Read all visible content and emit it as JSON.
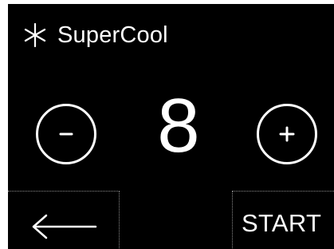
{
  "mode": {
    "title": "SuperCool",
    "icon": "snowflake-icon"
  },
  "setting": {
    "value": "8"
  },
  "controls": {
    "decrease_icon": "minus-icon",
    "increase_icon": "plus-icon",
    "back_icon": "arrow-left-icon",
    "start_label": "START"
  },
  "colors": {
    "background": "#000000",
    "foreground": "#ffffff",
    "separator": "#8a8a8a"
  }
}
